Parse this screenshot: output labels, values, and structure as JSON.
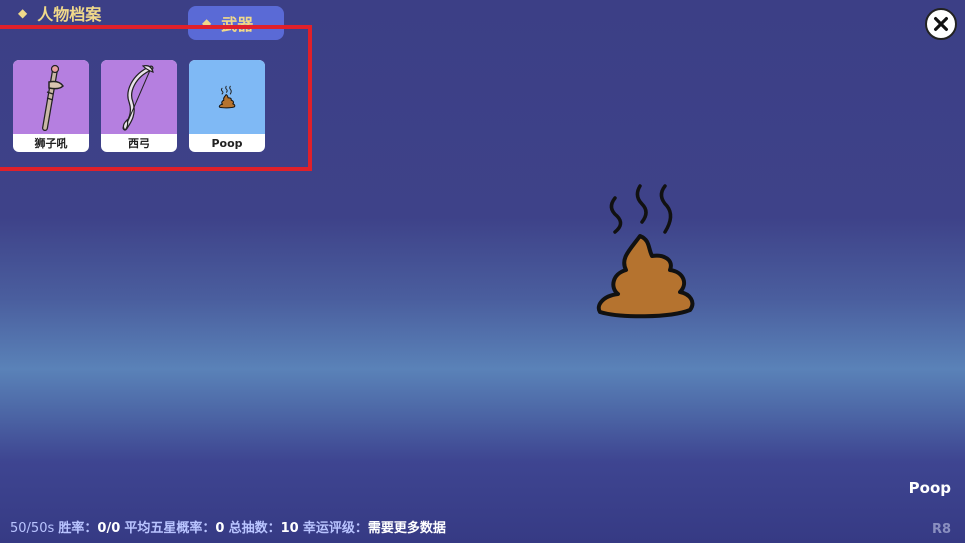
{
  "tabs": [
    {
      "label": "人物档案",
      "active": false
    },
    {
      "label": "武器",
      "active": true
    }
  ],
  "weapons": [
    {
      "name": "狮子吼",
      "icon": "staff-icon",
      "bg": "#b57fe0"
    },
    {
      "name": "西弓",
      "icon": "bow-icon",
      "bg": "#b57fe0"
    },
    {
      "name": "Poop",
      "icon": "poop-icon",
      "bg": "#7fb9f5"
    }
  ],
  "selected": {
    "name": "Poop",
    "icon": "poop-icon"
  },
  "status": {
    "time": "50/50s",
    "win_rate_label": "胜率：",
    "win_rate": "0/0",
    "avg5_label": "平均五星概率：",
    "avg5": "0",
    "total_label": "总抽数：",
    "total": "10",
    "luck_label": "幸运评级：",
    "luck": "需要更多数据"
  },
  "version": "R8",
  "colors": {
    "highlight": "#e0202a",
    "active_tab": "#5a6ad6",
    "tab_text": "#f0d98a"
  }
}
